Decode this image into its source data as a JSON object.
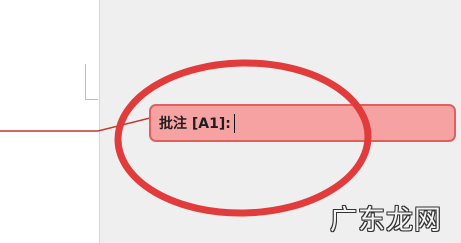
{
  "comment": {
    "label": "批注 [A1]:"
  },
  "annotation": {
    "ellipse_color": "#e23b3b",
    "balloon_color": "#f6a2a2",
    "leader_line_color": "#c0392b"
  },
  "watermark": {
    "text": "广东龙网"
  }
}
